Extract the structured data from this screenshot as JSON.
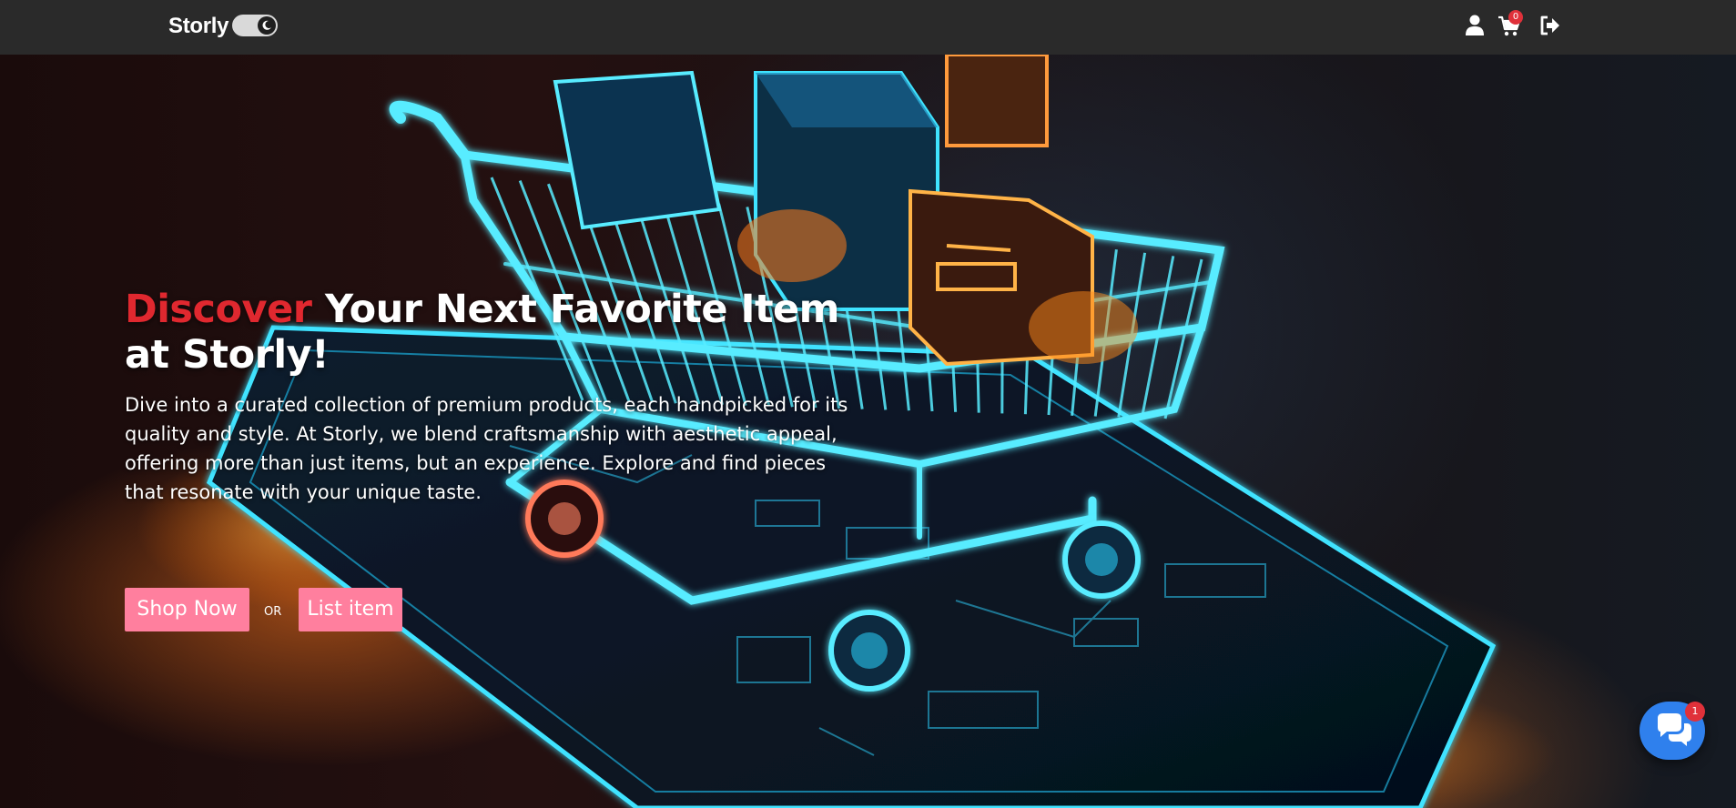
{
  "navbar": {
    "brand": "Storly",
    "theme_toggle_icon": "moon-icon",
    "icons": [
      "user-icon",
      "cart-icon",
      "logout-icon"
    ],
    "cart_count": "0"
  },
  "hero": {
    "headline_accent": "Discover",
    "headline_rest": " Your Next Favorite Item at Storly!",
    "subtext": "Dive into a curated collection of premium products, each handpicked for its quality and style. At Storly, we blend craftsmanship with aesthetic appeal, offering more than just items, but an experience. Explore and find pieces that resonate with your unique taste.",
    "shop_button": "Shop Now",
    "or_label": "OR",
    "list_button": "List item",
    "background_image": "neon shopping cart on smartphone illustration"
  },
  "chat": {
    "icon": "chat-bubbles-icon",
    "badge_count": "1"
  },
  "colors": {
    "navbar_bg": "#2a2a2a",
    "accent_red": "#e0282f",
    "button_pink": "#ff7f9e",
    "chat_blue": "#2f80ed",
    "badge_red": "#e0313a",
    "neon_cyan": "#3fe3ff"
  }
}
